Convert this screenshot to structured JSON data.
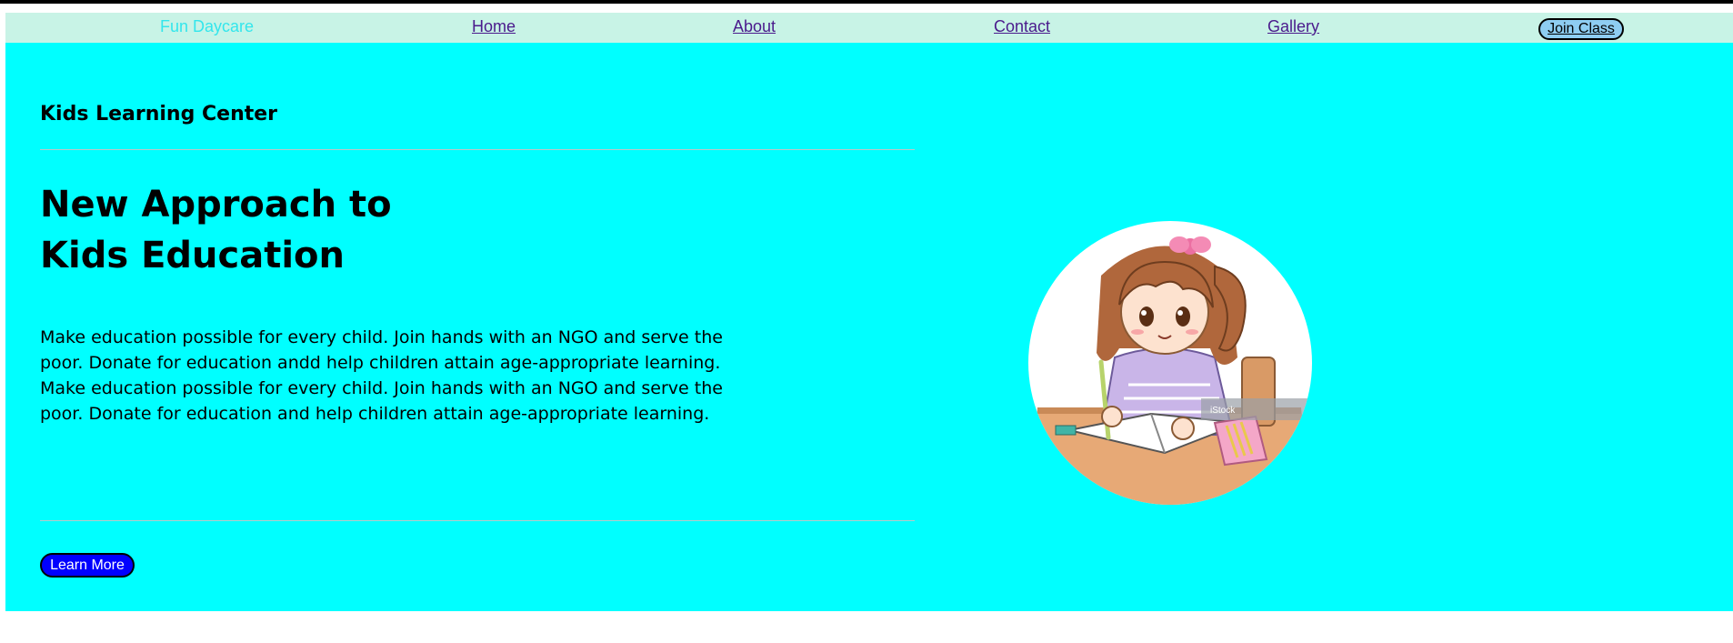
{
  "navbar": {
    "brand": "Fun Daycare",
    "links": [
      {
        "label": "Home"
      },
      {
        "label": "About"
      },
      {
        "label": "Contact"
      },
      {
        "label": "Gallery"
      }
    ],
    "join_button_label": "Join Class"
  },
  "hero": {
    "subtitle": "Kids Learning Center",
    "headline_line1": "New Approach to",
    "headline_line2": "Kids Education",
    "paragraph": "Make education possible for every child. Join hands with an NGO and serve the poor. Donate for education andd help children attain age-appropriate learning. Make education possible for every child. Join hands with an NGO and serve the poor. Donate for education and help children attain age-appropriate learning.",
    "learn_more_label": "Learn More",
    "image_watermark": "iStock"
  },
  "colors": {
    "hero_background": "#00ffff",
    "navbar_background": "#c8f3e6",
    "brand": "#33e6ec",
    "link": "#4a1a8c",
    "learn_more_button": "#0000ff",
    "join_button": "#8ecdf2"
  }
}
